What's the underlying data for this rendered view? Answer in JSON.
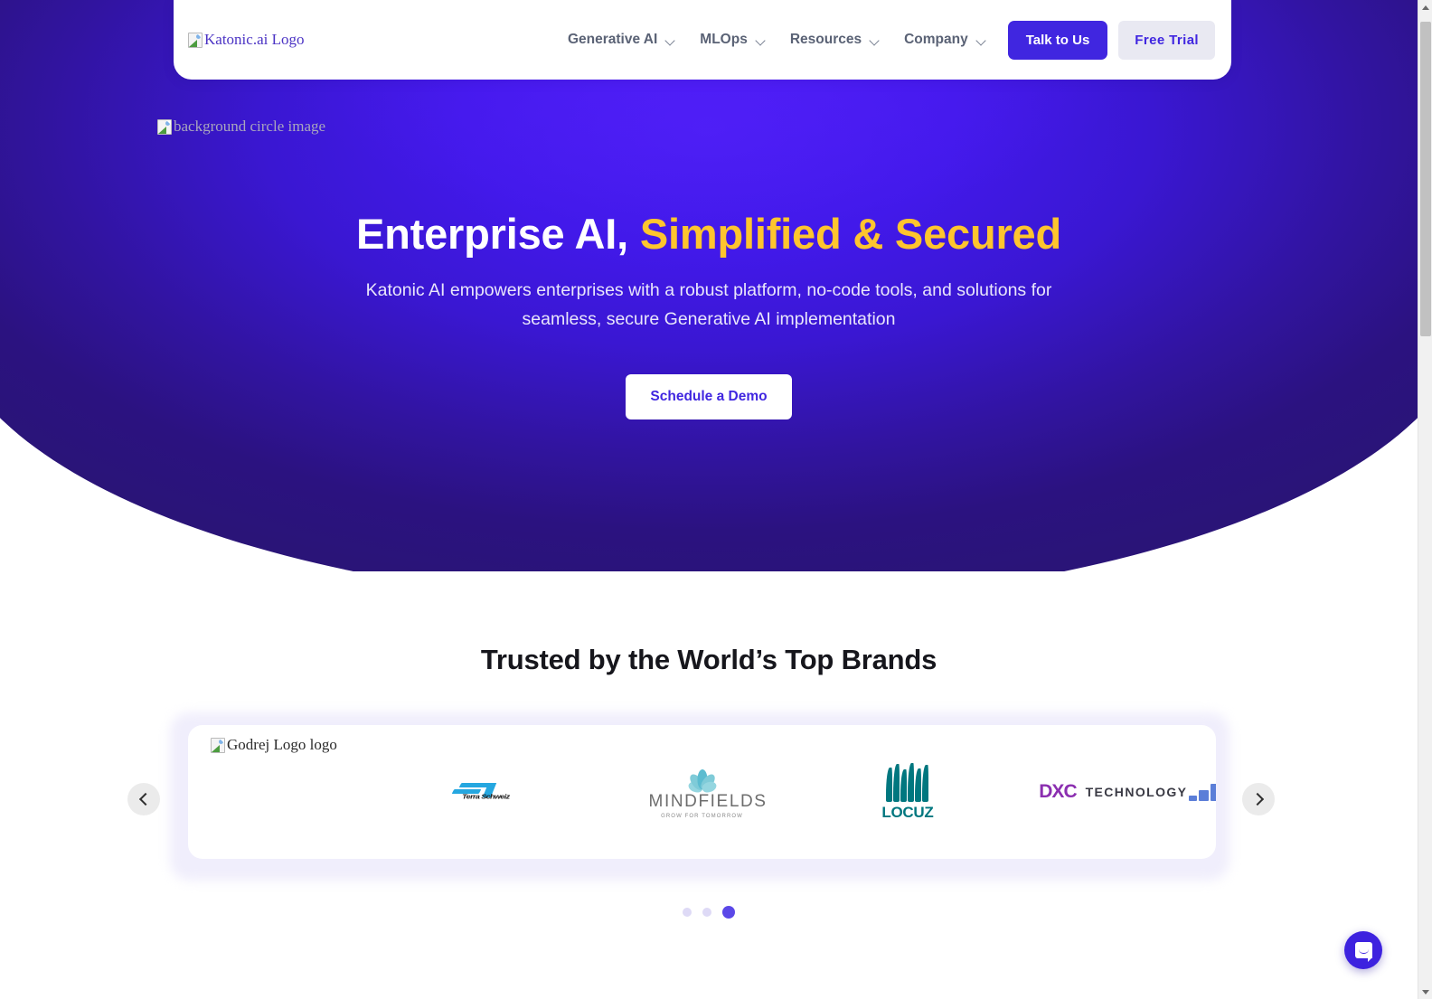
{
  "header": {
    "logo_alt": "Katonic.ai Logo",
    "nav": [
      {
        "label": "Generative AI",
        "icon": "chevron-down-icon"
      },
      {
        "label": "MLOps",
        "icon": "chevron-down-icon"
      },
      {
        "label": "Resources",
        "icon": "chevron-down-icon"
      },
      {
        "label": "Company",
        "icon": "chevron-down-icon"
      }
    ],
    "talk_button": "Talk to Us",
    "trial_button": "Free Trial"
  },
  "hero": {
    "background_image_alt": "background circle image",
    "headline_white": "Enterprise AI,",
    "headline_accent": "Simplified & Secured",
    "subhead": "Katonic AI empowers enterprises with a robust platform, no-code tools, and solutions for seamless, secure Generative AI implementation",
    "cta": "Schedule a Demo",
    "accent_color": "#fec52e",
    "bg_color_top": "#4a1ff2",
    "bg_color_bottom": "#2a1478"
  },
  "brands": {
    "title": "Trusted by the World’s Top Brands",
    "broken_logo_alt": "Godrej Logo logo",
    "logos": [
      {
        "name": "Terra Schweiz",
        "type": "wordmark",
        "color": "#25a7e0"
      },
      {
        "name": "MINDFIELDS",
        "tagline": "GROW FOR TOMORROW",
        "color": "#6d6d6d"
      },
      {
        "name": "LOCUZ",
        "color": "#00777f"
      },
      {
        "name": "DXC",
        "suffix": "TECHNOLOGY",
        "color": "#8b2fb0"
      },
      {
        "name": "partial-next-logo",
        "color": "#5b7ed8"
      }
    ],
    "prev_arrow": "chevron-left-icon",
    "next_arrow": "chevron-right-icon",
    "dots": [
      {
        "active": false
      },
      {
        "active": false
      },
      {
        "active": true
      }
    ]
  },
  "widgets": {
    "chat_launcher": "chat-bubble-icon",
    "chat_color": "#3d22df"
  },
  "scrollbar": {
    "up": "scroll-up-arrow",
    "down": "scroll-down-arrow"
  }
}
